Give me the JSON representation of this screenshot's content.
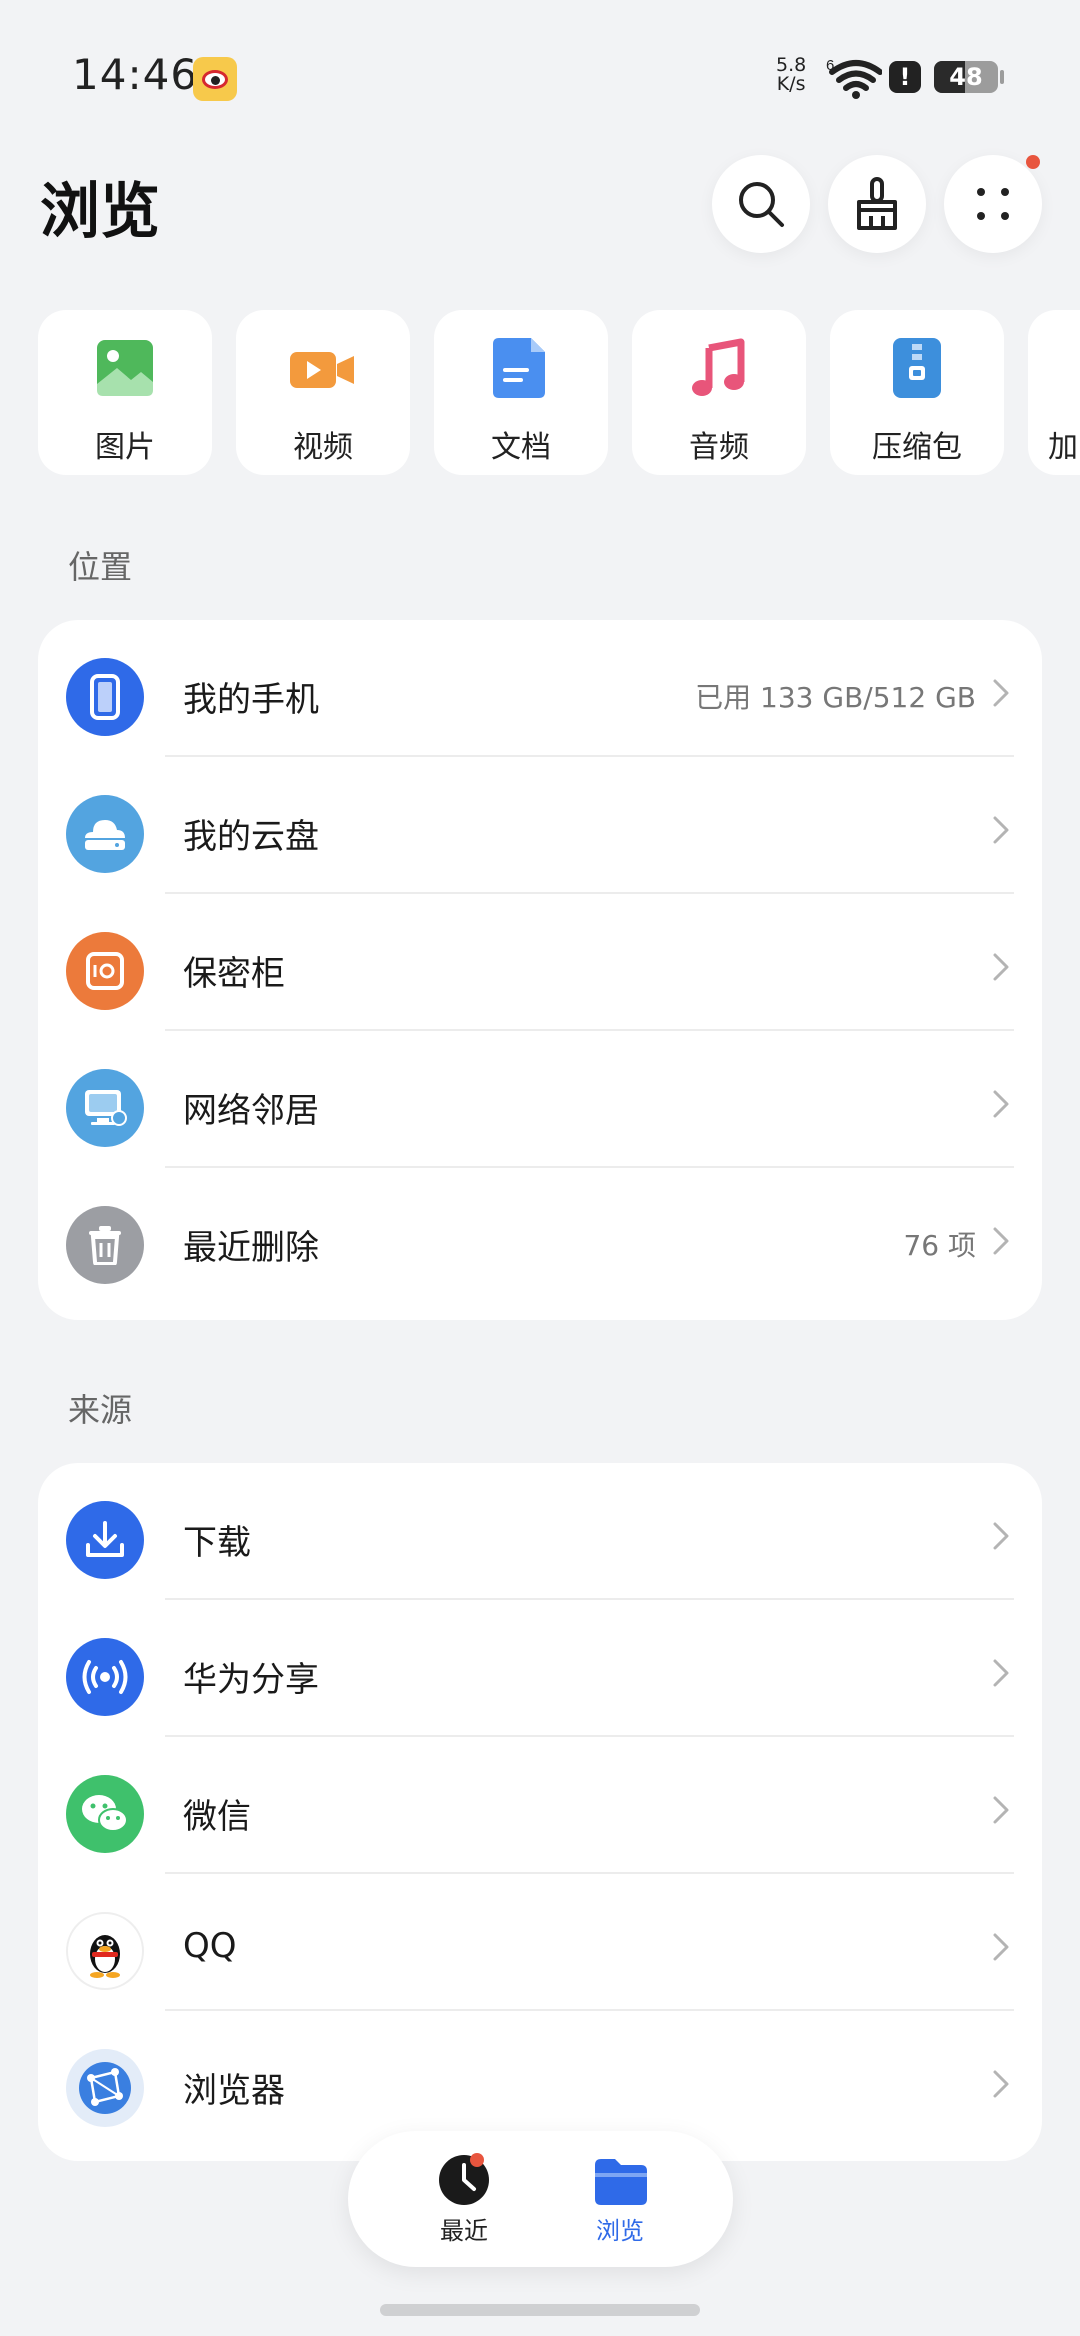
{
  "status_bar": {
    "time": "14:46",
    "net_speed_value": "5.8",
    "net_speed_unit": "K/s",
    "wifi_label": "6",
    "battery_level": "48",
    "battery_fraction": 0.48
  },
  "header": {
    "title": "浏览",
    "buttons": {
      "search_icon": "search-icon",
      "clean_icon": "broom-icon",
      "more_icon": "more-grid-icon"
    }
  },
  "categories": [
    {
      "label": "图片",
      "icon": "image-icon",
      "color": "#4fb85b"
    },
    {
      "label": "视频",
      "icon": "video-icon",
      "color": "#f39a3d"
    },
    {
      "label": "文档",
      "icon": "document-icon",
      "color": "#4a8ff0"
    },
    {
      "label": "音频",
      "icon": "music-icon",
      "color": "#e8557a"
    },
    {
      "label": "压缩包",
      "icon": "archive-icon",
      "color": "#3d8fdc"
    },
    {
      "label": "加",
      "icon": "",
      "color": "#ffffff"
    }
  ],
  "sections": {
    "location": {
      "title": "位置",
      "items": [
        {
          "label": "我的手机",
          "value": "已用 133 GB/512 GB",
          "icon": "phone-icon",
          "color": "#2f6ae8"
        },
        {
          "label": "我的云盘",
          "value": "",
          "icon": "cloud-drive-icon",
          "color": "#53a4e0"
        },
        {
          "label": "保密柜",
          "value": "",
          "icon": "safe-icon",
          "color": "#ec7a3b"
        },
        {
          "label": "网络邻居",
          "value": "",
          "icon": "network-icon",
          "color": "#53a4e0"
        },
        {
          "label": "最近删除",
          "value": "76 项",
          "icon": "trash-icon",
          "color": "#9c9ea3"
        }
      ]
    },
    "source": {
      "title": "来源",
      "items": [
        {
          "label": "下载",
          "value": "",
          "icon": "download-icon",
          "color": "#2f6ae8"
        },
        {
          "label": "华为分享",
          "value": "",
          "icon": "share-icon",
          "color": "#2f6ae8"
        },
        {
          "label": "微信",
          "value": "",
          "icon": "wechat-icon",
          "color": "#3fc16c"
        },
        {
          "label": "QQ",
          "value": "",
          "icon": "qq-icon",
          "color": "#ffffff"
        },
        {
          "label": "浏览器",
          "value": "",
          "icon": "browser-icon",
          "color": "#3a7fe0"
        }
      ]
    }
  },
  "bottom_nav": {
    "recent": {
      "label": "最近",
      "icon": "clock-icon"
    },
    "browse": {
      "label": "浏览",
      "icon": "folder-icon",
      "active_color": "#2f6ae8"
    }
  }
}
